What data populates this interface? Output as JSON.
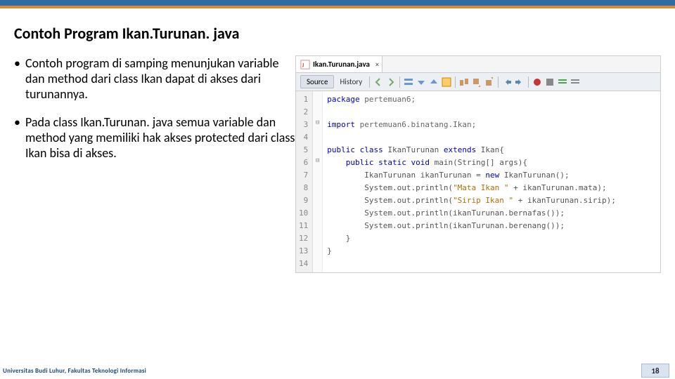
{
  "title": "Contoh Program Ikan.Turunan. java",
  "bullets": [
    "Contoh program di samping menunjukan variable dan method dari class Ikan dapat di akses dari turunannya.",
    "Pada class Ikan.Turunan. java semua variable dan method yang memiliki hak akses protected dari class Ikan bisa di akses."
  ],
  "tab": {
    "filename": "Ikan.Turunan.java",
    "close": "×"
  },
  "toolbar": {
    "source": "Source",
    "history": "History"
  },
  "code": {
    "lines": [
      "1",
      "2",
      "3",
      "4",
      "5",
      "6",
      "7",
      "8",
      "9",
      "10",
      "11",
      "12",
      "13",
      "14"
    ],
    "l1_kw": "package",
    "l1_rest": " pertemuan6;",
    "l3_kw": "import",
    "l3_rest": " pertemuan6.binatang.Ikan;",
    "l5_a": "public class",
    "l5_b": " IkanTurunan ",
    "l5_c": "extends",
    "l5_d": " Ikan{",
    "l6_a": "    public static void",
    "l6_b": " main(String[] args){",
    "l7_a": "        IkanTurunan ikanTurunan = ",
    "l7_b": "new",
    "l7_c": " IkanTurunan();",
    "l8_a": "        System.out.println(",
    "l8_s": "\"Mata Ikan \"",
    "l8_b": " + ikanTurunan.mata);",
    "l9_a": "        System.out.println(",
    "l9_s": "\"Sirip Ikan \"",
    "l9_b": " + ikanTurunan.sirip);",
    "l10": "        System.out.println(ikanTurunan.bernafas());",
    "l11": "        System.out.println(ikanTurunan.berenang());",
    "l12": "    }",
    "l13": "}"
  },
  "footer": {
    "uni": "Universitas Budi Luhur, Fakultas Teknologi Informasi",
    "page": "18"
  }
}
